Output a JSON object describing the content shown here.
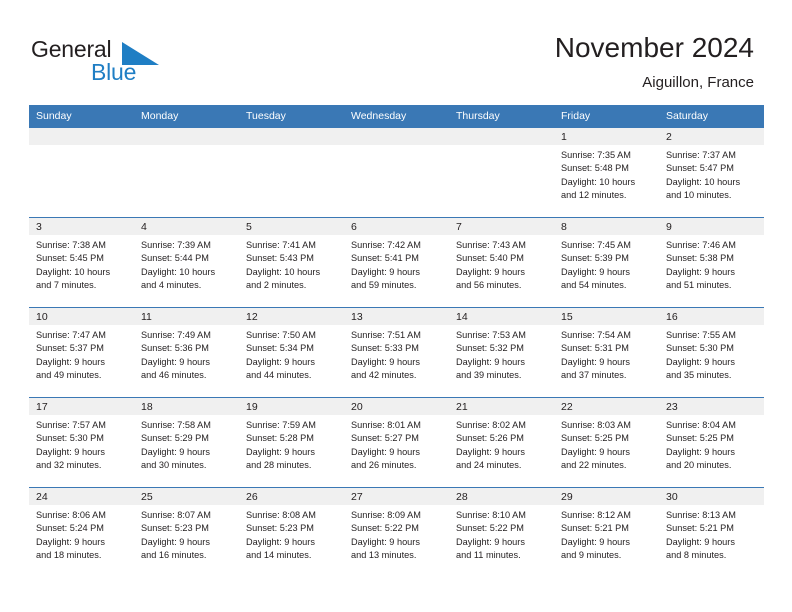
{
  "brand": {
    "name_part1": "General",
    "name_part2": "Blue",
    "logo_icon": "triangle-flag-icon",
    "accent_color": "#1f7ec4"
  },
  "header": {
    "title": "November 2024",
    "subtitle": "Aiguillon, France"
  },
  "theme": {
    "header_row_bg": "#3a78b5",
    "daynum_strip_bg": "#f0f0f0",
    "text_color": "#231f20",
    "grid_line": "#3a78b5"
  },
  "weekday_headers": [
    "Sunday",
    "Monday",
    "Tuesday",
    "Wednesday",
    "Thursday",
    "Friday",
    "Saturday"
  ],
  "weeks": [
    [
      {
        "day": "",
        "empty": true,
        "sunrise": "",
        "sunset": "",
        "daylight_line1": "",
        "daylight_line2": ""
      },
      {
        "day": "",
        "empty": true,
        "sunrise": "",
        "sunset": "",
        "daylight_line1": "",
        "daylight_line2": ""
      },
      {
        "day": "",
        "empty": true,
        "sunrise": "",
        "sunset": "",
        "daylight_line1": "",
        "daylight_line2": ""
      },
      {
        "day": "",
        "empty": true,
        "sunrise": "",
        "sunset": "",
        "daylight_line1": "",
        "daylight_line2": ""
      },
      {
        "day": "",
        "empty": true,
        "sunrise": "",
        "sunset": "",
        "daylight_line1": "",
        "daylight_line2": ""
      },
      {
        "day": "1",
        "empty": false,
        "sunrise": "Sunrise: 7:35 AM",
        "sunset": "Sunset: 5:48 PM",
        "daylight_line1": "Daylight: 10 hours",
        "daylight_line2": "and 12 minutes."
      },
      {
        "day": "2",
        "empty": false,
        "sunrise": "Sunrise: 7:37 AM",
        "sunset": "Sunset: 5:47 PM",
        "daylight_line1": "Daylight: 10 hours",
        "daylight_line2": "and 10 minutes."
      }
    ],
    [
      {
        "day": "3",
        "empty": false,
        "sunrise": "Sunrise: 7:38 AM",
        "sunset": "Sunset: 5:45 PM",
        "daylight_line1": "Daylight: 10 hours",
        "daylight_line2": "and 7 minutes."
      },
      {
        "day": "4",
        "empty": false,
        "sunrise": "Sunrise: 7:39 AM",
        "sunset": "Sunset: 5:44 PM",
        "daylight_line1": "Daylight: 10 hours",
        "daylight_line2": "and 4 minutes."
      },
      {
        "day": "5",
        "empty": false,
        "sunrise": "Sunrise: 7:41 AM",
        "sunset": "Sunset: 5:43 PM",
        "daylight_line1": "Daylight: 10 hours",
        "daylight_line2": "and 2 minutes."
      },
      {
        "day": "6",
        "empty": false,
        "sunrise": "Sunrise: 7:42 AM",
        "sunset": "Sunset: 5:41 PM",
        "daylight_line1": "Daylight: 9 hours",
        "daylight_line2": "and 59 minutes."
      },
      {
        "day": "7",
        "empty": false,
        "sunrise": "Sunrise: 7:43 AM",
        "sunset": "Sunset: 5:40 PM",
        "daylight_line1": "Daylight: 9 hours",
        "daylight_line2": "and 56 minutes."
      },
      {
        "day": "8",
        "empty": false,
        "sunrise": "Sunrise: 7:45 AM",
        "sunset": "Sunset: 5:39 PM",
        "daylight_line1": "Daylight: 9 hours",
        "daylight_line2": "and 54 minutes."
      },
      {
        "day": "9",
        "empty": false,
        "sunrise": "Sunrise: 7:46 AM",
        "sunset": "Sunset: 5:38 PM",
        "daylight_line1": "Daylight: 9 hours",
        "daylight_line2": "and 51 minutes."
      }
    ],
    [
      {
        "day": "10",
        "empty": false,
        "sunrise": "Sunrise: 7:47 AM",
        "sunset": "Sunset: 5:37 PM",
        "daylight_line1": "Daylight: 9 hours",
        "daylight_line2": "and 49 minutes."
      },
      {
        "day": "11",
        "empty": false,
        "sunrise": "Sunrise: 7:49 AM",
        "sunset": "Sunset: 5:36 PM",
        "daylight_line1": "Daylight: 9 hours",
        "daylight_line2": "and 46 minutes."
      },
      {
        "day": "12",
        "empty": false,
        "sunrise": "Sunrise: 7:50 AM",
        "sunset": "Sunset: 5:34 PM",
        "daylight_line1": "Daylight: 9 hours",
        "daylight_line2": "and 44 minutes."
      },
      {
        "day": "13",
        "empty": false,
        "sunrise": "Sunrise: 7:51 AM",
        "sunset": "Sunset: 5:33 PM",
        "daylight_line1": "Daylight: 9 hours",
        "daylight_line2": "and 42 minutes."
      },
      {
        "day": "14",
        "empty": false,
        "sunrise": "Sunrise: 7:53 AM",
        "sunset": "Sunset: 5:32 PM",
        "daylight_line1": "Daylight: 9 hours",
        "daylight_line2": "and 39 minutes."
      },
      {
        "day": "15",
        "empty": false,
        "sunrise": "Sunrise: 7:54 AM",
        "sunset": "Sunset: 5:31 PM",
        "daylight_line1": "Daylight: 9 hours",
        "daylight_line2": "and 37 minutes."
      },
      {
        "day": "16",
        "empty": false,
        "sunrise": "Sunrise: 7:55 AM",
        "sunset": "Sunset: 5:30 PM",
        "daylight_line1": "Daylight: 9 hours",
        "daylight_line2": "and 35 minutes."
      }
    ],
    [
      {
        "day": "17",
        "empty": false,
        "sunrise": "Sunrise: 7:57 AM",
        "sunset": "Sunset: 5:30 PM",
        "daylight_line1": "Daylight: 9 hours",
        "daylight_line2": "and 32 minutes."
      },
      {
        "day": "18",
        "empty": false,
        "sunrise": "Sunrise: 7:58 AM",
        "sunset": "Sunset: 5:29 PM",
        "daylight_line1": "Daylight: 9 hours",
        "daylight_line2": "and 30 minutes."
      },
      {
        "day": "19",
        "empty": false,
        "sunrise": "Sunrise: 7:59 AM",
        "sunset": "Sunset: 5:28 PM",
        "daylight_line1": "Daylight: 9 hours",
        "daylight_line2": "and 28 minutes."
      },
      {
        "day": "20",
        "empty": false,
        "sunrise": "Sunrise: 8:01 AM",
        "sunset": "Sunset: 5:27 PM",
        "daylight_line1": "Daylight: 9 hours",
        "daylight_line2": "and 26 minutes."
      },
      {
        "day": "21",
        "empty": false,
        "sunrise": "Sunrise: 8:02 AM",
        "sunset": "Sunset: 5:26 PM",
        "daylight_line1": "Daylight: 9 hours",
        "daylight_line2": "and 24 minutes."
      },
      {
        "day": "22",
        "empty": false,
        "sunrise": "Sunrise: 8:03 AM",
        "sunset": "Sunset: 5:25 PM",
        "daylight_line1": "Daylight: 9 hours",
        "daylight_line2": "and 22 minutes."
      },
      {
        "day": "23",
        "empty": false,
        "sunrise": "Sunrise: 8:04 AM",
        "sunset": "Sunset: 5:25 PM",
        "daylight_line1": "Daylight: 9 hours",
        "daylight_line2": "and 20 minutes."
      }
    ],
    [
      {
        "day": "24",
        "empty": false,
        "sunrise": "Sunrise: 8:06 AM",
        "sunset": "Sunset: 5:24 PM",
        "daylight_line1": "Daylight: 9 hours",
        "daylight_line2": "and 18 minutes."
      },
      {
        "day": "25",
        "empty": false,
        "sunrise": "Sunrise: 8:07 AM",
        "sunset": "Sunset: 5:23 PM",
        "daylight_line1": "Daylight: 9 hours",
        "daylight_line2": "and 16 minutes."
      },
      {
        "day": "26",
        "empty": false,
        "sunrise": "Sunrise: 8:08 AM",
        "sunset": "Sunset: 5:23 PM",
        "daylight_line1": "Daylight: 9 hours",
        "daylight_line2": "and 14 minutes."
      },
      {
        "day": "27",
        "empty": false,
        "sunrise": "Sunrise: 8:09 AM",
        "sunset": "Sunset: 5:22 PM",
        "daylight_line1": "Daylight: 9 hours",
        "daylight_line2": "and 13 minutes."
      },
      {
        "day": "28",
        "empty": false,
        "sunrise": "Sunrise: 8:10 AM",
        "sunset": "Sunset: 5:22 PM",
        "daylight_line1": "Daylight: 9 hours",
        "daylight_line2": "and 11 minutes."
      },
      {
        "day": "29",
        "empty": false,
        "sunrise": "Sunrise: 8:12 AM",
        "sunset": "Sunset: 5:21 PM",
        "daylight_line1": "Daylight: 9 hours",
        "daylight_line2": "and 9 minutes."
      },
      {
        "day": "30",
        "empty": false,
        "sunrise": "Sunrise: 8:13 AM",
        "sunset": "Sunset: 5:21 PM",
        "daylight_line1": "Daylight: 9 hours",
        "daylight_line2": "and 8 minutes."
      }
    ]
  ]
}
